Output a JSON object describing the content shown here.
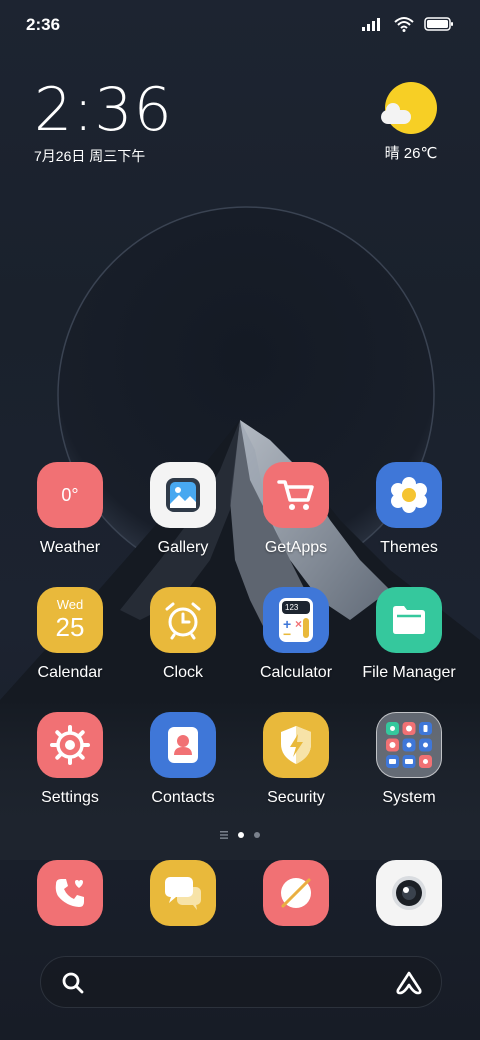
{
  "status_bar": {
    "time": "2:36",
    "icons": [
      "signal-icon",
      "wifi-icon",
      "battery-icon"
    ]
  },
  "clock_widget": {
    "time": "2:36",
    "date": "7月26日 周三下午"
  },
  "weather_widget": {
    "text": "晴 26℃",
    "icon": "sun-cloud-icon"
  },
  "apps": [
    {
      "label": "Weather",
      "badge": "0°",
      "color": "#f17174"
    },
    {
      "label": "Gallery",
      "color": "#f4f4f4"
    },
    {
      "label": "GetApps",
      "color": "#f17174"
    },
    {
      "label": "Themes",
      "color": "#3f77d8"
    },
    {
      "label": "Calendar",
      "weekday": "Wed",
      "day": "25",
      "color": "#e9b93b"
    },
    {
      "label": "Clock",
      "color": "#e9b93b"
    },
    {
      "label": "Calculator",
      "display": "123",
      "color": "#3f77d8"
    },
    {
      "label": "File Manager",
      "color": "#35c89d"
    },
    {
      "label": "Settings",
      "color": "#f17174"
    },
    {
      "label": "Contacts",
      "color": "#3f77d8"
    },
    {
      "label": "Security",
      "color": "#e9b93b"
    },
    {
      "label": "System",
      "color": "#a9b0ba"
    }
  ],
  "page_indicator": {
    "pages": 3,
    "active": 1
  },
  "dock": [
    {
      "name": "phone",
      "color": "#f17174"
    },
    {
      "name": "messages",
      "color": "#e9b93b"
    },
    {
      "name": "browser",
      "color": "#f17174"
    },
    {
      "name": "camera",
      "color": "#f4f4f4"
    }
  ],
  "search_bar": {
    "icon": "search-icon",
    "assistant_icon": "assistant-icon"
  }
}
